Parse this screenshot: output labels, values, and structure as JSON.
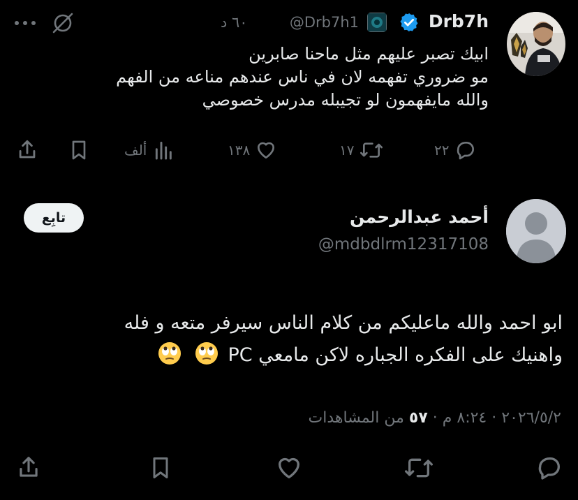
{
  "parent_tweet": {
    "display_name": "Drb7h",
    "handle": "@Drb7h1",
    "time": "٦٠ د",
    "text_lines": [
      "ابيك تصبر عليهم مثل ماحنا صابرين",
      "مو ضروري تفهمه لان في ناس عندهم مناعه من الفهم",
      "والله مايفهمون لو تجيبله مدرس خصوصي"
    ],
    "replies": "٢٢",
    "retweets": "١٧",
    "likes": "١٣٨",
    "views": "ألف",
    "icons": {
      "verified": "verified-badge-icon",
      "muted": "eye-slash-icon",
      "more": "more-dots-icon"
    }
  },
  "reply_tweet": {
    "display_name": "أحمد عبدالرحمن",
    "handle": "@mdbdlrm12317108",
    "follow_label": "تابِع",
    "text_line1": "ابو احمد والله ماعليكم من كلام الناس سيرفر متعه و فله",
    "text_line2": "واهنيك على الفكره الجباره لاكن مامعي PC",
    "emoji": "face-with-rolling-eyes",
    "date": "٢٠٢٦/٥/٢",
    "time": "٨:٢٤ م",
    "views_count": "٥٧",
    "views_label": "من المشاهدات"
  },
  "colors": {
    "background": "#000000",
    "text": "#e7e9ea",
    "muted": "#71767b",
    "verified": "#1d9bf0"
  }
}
